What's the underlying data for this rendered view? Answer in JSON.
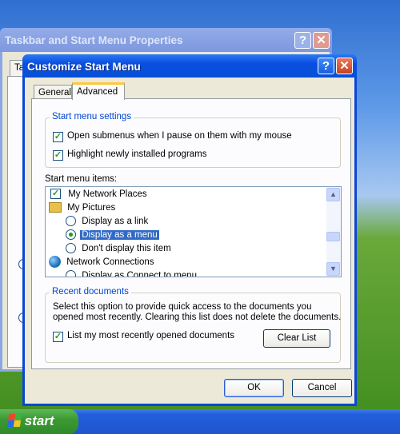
{
  "back_window": {
    "title": "Taskbar and Start Menu Properties",
    "tab": "Ta",
    "help": "?",
    "close": "✕"
  },
  "dialog": {
    "title": "Customize Start Menu",
    "help": "?",
    "close": "✕",
    "tabs": [
      {
        "label": "General",
        "active": false
      },
      {
        "label": "Advanced",
        "active": true
      }
    ],
    "settings_group": {
      "legend": "Start menu settings",
      "options": [
        {
          "label": "Open submenus when I pause on them with my mouse",
          "checked": true
        },
        {
          "label": "Highlight newly installed programs",
          "checked": true
        }
      ]
    },
    "items_label": "Start menu items:",
    "items": [
      {
        "type": "checkbox",
        "label": "My Network Places",
        "checked": true
      },
      {
        "type": "header",
        "label": "My Pictures",
        "icon": "pictures-folder-icon"
      },
      {
        "type": "radio",
        "label": "Display as a link",
        "checked": false
      },
      {
        "type": "radio",
        "label": "Display as a menu",
        "checked": true,
        "selected": true
      },
      {
        "type": "radio",
        "label": "Don't display this item",
        "checked": false
      },
      {
        "type": "header",
        "label": "Network Connections",
        "icon": "network-globe-icon"
      },
      {
        "type": "radio",
        "label": "Display as Connect to menu",
        "checked": false
      }
    ],
    "recent_group": {
      "legend": "Recent documents",
      "description_line1": "Select this option to provide quick access to the documents you",
      "description_line2": "opened most recently.  Clearing this list does not delete the documents.",
      "checkbox": {
        "label": "List my most recently opened documents",
        "checked": true
      },
      "clear_button": "Clear List"
    },
    "ok": "OK",
    "cancel": "Cancel"
  },
  "taskbar": {
    "start": "start"
  },
  "colors": {
    "title_blue": "#0a4ee0",
    "selection": "#316ac5",
    "start_green": "#3c9a32",
    "taskbar": "#245edb"
  }
}
